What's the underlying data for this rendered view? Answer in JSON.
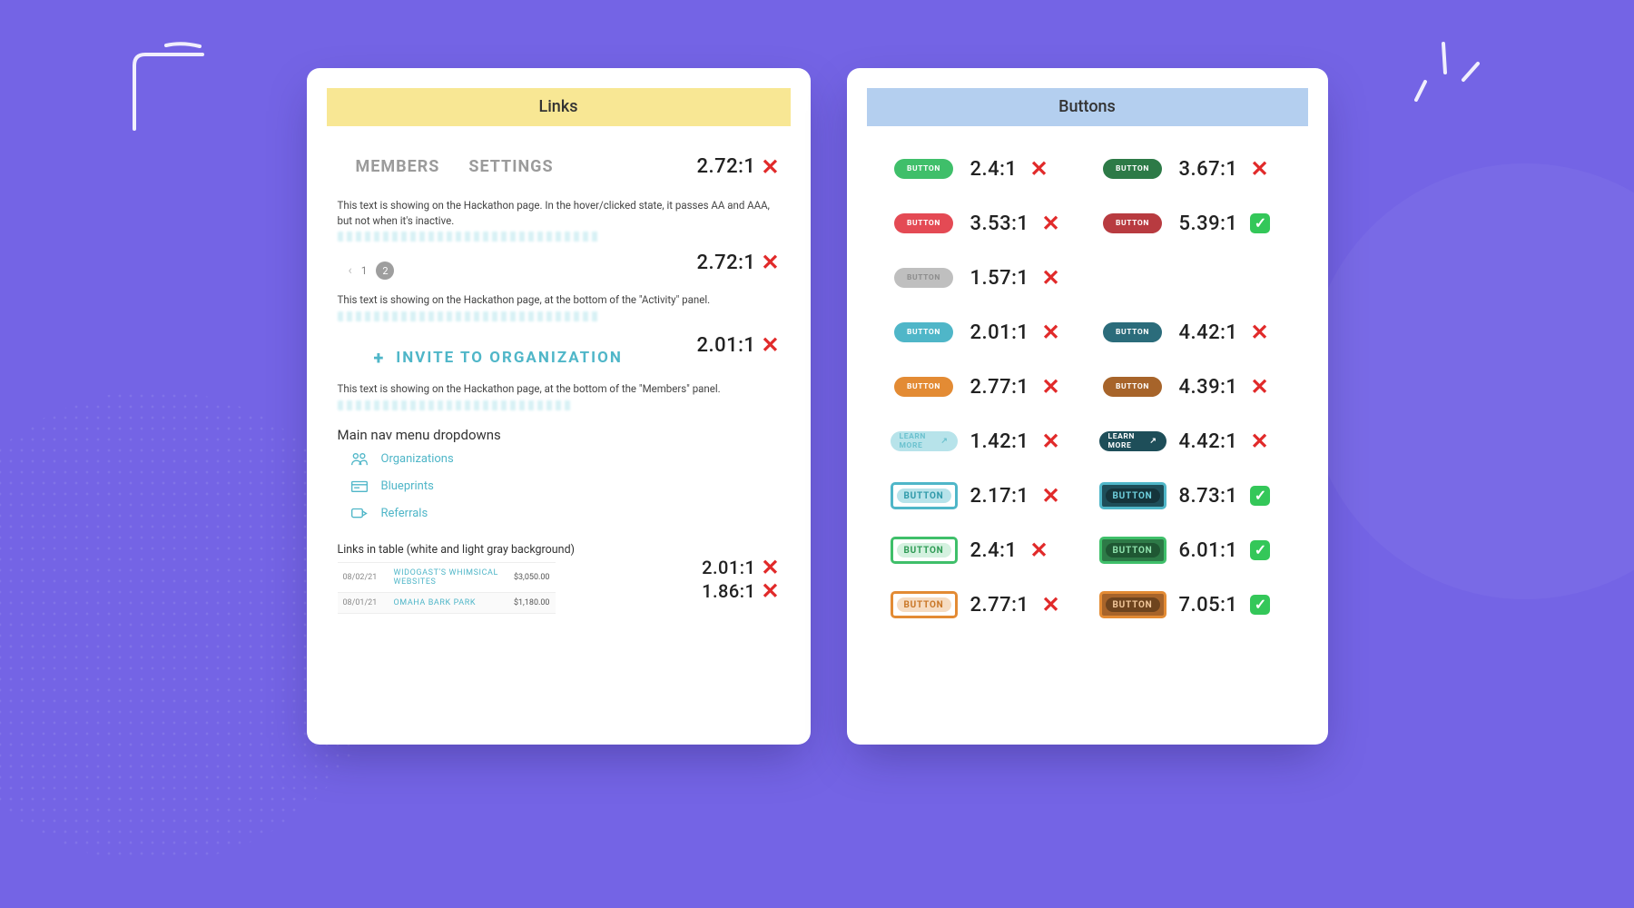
{
  "links_card": {
    "title": "Links",
    "tabs": {
      "members": "MEMBERS",
      "settings": "SETTINGS",
      "ratio": "2.72:1",
      "pass": false
    },
    "caption1": "This text is showing on the Hackathon page. In the hover/clicked state, it passes AA and AAA, but not when it's inactive.",
    "pager": {
      "prev": "‹",
      "p1": "1",
      "p2": "2",
      "ratio": "2.72:1",
      "pass": false
    },
    "caption2": "This text is showing on the Hackathon page, at the bottom of the \"Activity\" panel.",
    "invite": {
      "label": "INVITE TO ORGANIZATION",
      "plus": "+",
      "ratio": "2.01:1",
      "pass": false
    },
    "caption3": "This text is showing on the Hackathon page, at the bottom of the \"Members\" panel.",
    "nav_heading": "Main nav menu dropdowns",
    "nav_items": [
      {
        "label": "Organizations"
      },
      {
        "label": "Blueprints"
      },
      {
        "label": "Referrals"
      }
    ],
    "table_title": "Links in table (white and light gray background)",
    "table_rows": [
      {
        "date": "08/02/21",
        "name": "WIDOGAST'S WHIMSICAL WEBSITES",
        "price": "$3,050.00"
      },
      {
        "date": "08/01/21",
        "name": "OMAHA BARK PARK",
        "price": "$1,180.00"
      }
    ],
    "table_ratios": [
      {
        "ratio": "2.01:1",
        "pass": false
      },
      {
        "ratio": "1.86:1",
        "pass": false
      }
    ]
  },
  "buttons_card": {
    "title": "Buttons",
    "button_label": "BUTTON",
    "learn_label": "LEARN MORE",
    "rows": [
      [
        {
          "kind": "pill",
          "color": "bg-green-l",
          "ratio": "2.4:1",
          "pass": false
        },
        {
          "kind": "pill",
          "color": "bg-green-d",
          "ratio": "3.67:1",
          "pass": false
        }
      ],
      [
        {
          "kind": "pill",
          "color": "bg-red-l",
          "ratio": "3.53:1",
          "pass": false
        },
        {
          "kind": "pill",
          "color": "bg-red-d",
          "ratio": "5.39:1",
          "pass": true
        }
      ],
      [
        {
          "kind": "pill",
          "color": "bg-gray",
          "text_class": "txt-gray",
          "ratio": "1.57:1",
          "pass": false
        },
        {
          "kind": "empty"
        }
      ],
      [
        {
          "kind": "pill",
          "color": "bg-cyan-l",
          "ratio": "2.01:1",
          "pass": false
        },
        {
          "kind": "pill",
          "color": "bg-cyan-d",
          "ratio": "4.42:1",
          "pass": false
        }
      ],
      [
        {
          "kind": "pill",
          "color": "bg-orange-l",
          "ratio": "2.77:1",
          "pass": false
        },
        {
          "kind": "pill",
          "color": "bg-orange-d",
          "ratio": "4.39:1",
          "pass": false
        }
      ],
      [
        {
          "kind": "learn",
          "color": "bg-cyan-p",
          "text_class": "txt-cyan",
          "ratio": "1.42:1",
          "pass": false
        },
        {
          "kind": "learn",
          "color": "bg-navy",
          "text_class": "txt-white",
          "ratio": "4.42:1",
          "pass": false
        }
      ],
      [
        {
          "kind": "box",
          "box": "box-cyan-l",
          "ratio": "2.17:1",
          "pass": false
        },
        {
          "kind": "box",
          "box": "box-navy",
          "ratio": "8.73:1",
          "pass": true
        }
      ],
      [
        {
          "kind": "box",
          "box": "box-green-l",
          "ratio": "2.4:1",
          "pass": false
        },
        {
          "kind": "box",
          "box": "box-green-d",
          "ratio": "6.01:1",
          "pass": true
        }
      ],
      [
        {
          "kind": "box",
          "box": "box-orange-l",
          "ratio": "2.77:1",
          "pass": false
        },
        {
          "kind": "box",
          "box": "box-orange-d",
          "ratio": "7.05:1",
          "pass": true
        }
      ]
    ]
  }
}
